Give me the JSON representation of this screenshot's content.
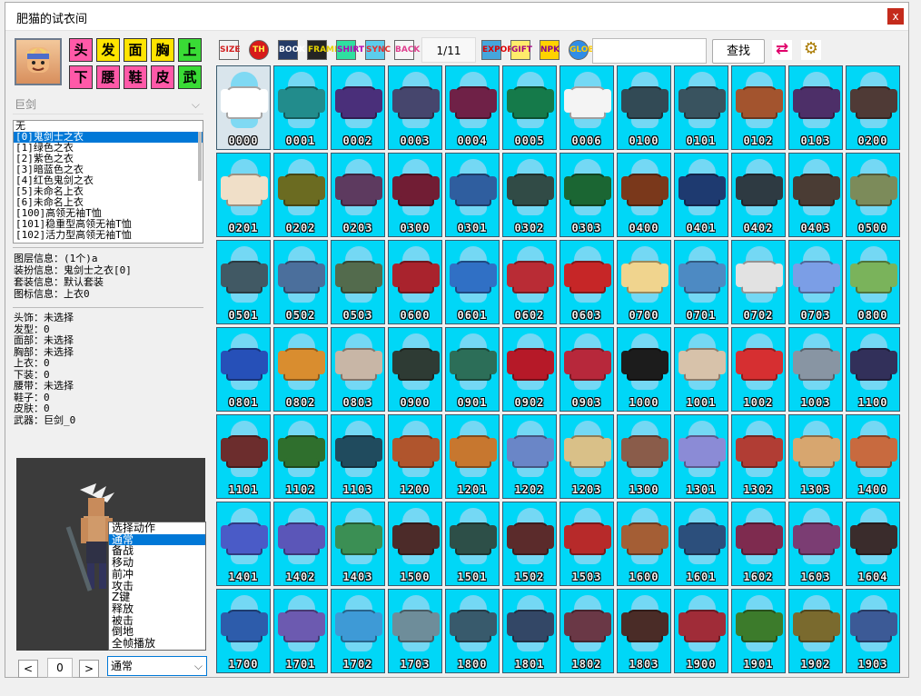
{
  "window": {
    "title": "肥猫的试衣间",
    "close_label": "x"
  },
  "weapon_type": "巨剑",
  "categories": [
    "头",
    "发",
    "面",
    "胸",
    "上",
    "下",
    "腰",
    "鞋",
    "皮",
    "武"
  ],
  "equip_list": [
    "无",
    "[0]鬼剑士之衣",
    "[1]绿色之衣",
    "[2]紫色之衣",
    "[3]暗蓝色之衣",
    "[4]红色鬼剑之衣",
    "[5]未命名上衣",
    "[6]未命名上衣",
    "[100]高领无袖T恤",
    "[101]稳重型高领无袖T恤",
    "[102]活力型高领无袖T恤"
  ],
  "layer_info": [
    "图层信息：(1个)a",
    "装扮信息：鬼剑士之衣[0]",
    "套装信息：默认套装",
    "图标信息：上衣0"
  ],
  "equipment": [
    "头饰：未选择",
    "发型：0",
    "面部：未选择",
    "胸部：未选择",
    "上衣：0",
    "下装：0",
    "腰带：未选择",
    "鞋子：0",
    "皮肤：0",
    "武器：巨剑_0"
  ],
  "actions": [
    "选择动作",
    "通常",
    "备战",
    "移动",
    "前冲",
    "攻击",
    "Z键",
    "释放",
    "被击",
    "倒地",
    "全帧播放"
  ],
  "selected_action": "通常",
  "frame_index": "0",
  "nav": {
    "prev": "<",
    "next": ">"
  },
  "toolbar": {
    "buttons": [
      "SIZE",
      "TH",
      "BOOK",
      "FRAME",
      "SHIRT",
      "SYNC",
      "BACK",
      "EXPORT",
      "GIFT",
      "NPK",
      "GLOBE"
    ],
    "page": "1/11",
    "search_label": "查找",
    "search_value": "",
    "search_placeholder": ""
  },
  "items": [
    "0000",
    "0001",
    "0002",
    "0003",
    "0004",
    "0005",
    "0006",
    "0100",
    "0101",
    "0102",
    "0103",
    "0200",
    "0201",
    "0202",
    "0203",
    "0300",
    "0301",
    "0302",
    "0303",
    "0400",
    "0401",
    "0402",
    "0403",
    "0500",
    "0501",
    "0502",
    "0503",
    "0600",
    "0601",
    "0602",
    "0603",
    "0700",
    "0701",
    "0702",
    "0703",
    "0800",
    "0801",
    "0802",
    "0803",
    "0900",
    "0901",
    "0902",
    "0903",
    "1000",
    "1001",
    "1002",
    "1003",
    "1100",
    "1101",
    "1102",
    "1103",
    "1200",
    "1201",
    "1202",
    "1203",
    "1300",
    "1301",
    "1302",
    "1303",
    "1400",
    "1401",
    "1402",
    "1403",
    "1500",
    "1501",
    "1502",
    "1503",
    "1600",
    "1601",
    "1602",
    "1603",
    "1604",
    "1700",
    "1701",
    "1702",
    "1703",
    "1800",
    "1801",
    "1802",
    "1803",
    "1900",
    "1901",
    "1902",
    "1903"
  ],
  "item_colors": [
    "#ffffff",
    "#228c8c",
    "#4a2f7a",
    "#46466d",
    "#6f2147",
    "#157a4a",
    "#f4f4f4",
    "#324a55",
    "#39535f",
    "#a3542e",
    "#4d2f68",
    "#4f3a36",
    "#f0dfc8",
    "#6b6b21",
    "#5d3a5f",
    "#711d34",
    "#2f5e9f",
    "#314b46",
    "#1b6633",
    "#7a381b",
    "#1e3a70",
    "#2e3a42",
    "#4a3c34",
    "#7c8b5a",
    "#415964",
    "#4b6f9c",
    "#536b4d",
    "#a9232d",
    "#3070c5",
    "#b92c35",
    "#c62627",
    "#f0d48e",
    "#4d8ac3",
    "#e2e2e2",
    "#7b9ee6",
    "#7ab35b",
    "#2650b8",
    "#d98d2f",
    "#c8b6a6",
    "#2e3b34",
    "#2c6e58",
    "#b61928",
    "#b7283b",
    "#1c1c1c",
    "#d7c2aa",
    "#d62f31",
    "#8895a3",
    "#32305a",
    "#6c2d2d",
    "#2f6f2d",
    "#204b5e",
    "#b0552d",
    "#c7772f",
    "#6a86c7",
    "#d9c088",
    "#8a5c4a",
    "#8b8bd6",
    "#b13d34",
    "#d7a66f",
    "#c86a3f",
    "#4a5bc7",
    "#5b56b8",
    "#3b8f54",
    "#4c2b29",
    "#2d4f48",
    "#5b2b2b",
    "#b72a2a",
    "#a45e35",
    "#2c4f7c",
    "#7e2b4f",
    "#7b3d73",
    "#3a2c2c",
    "#2d5cab",
    "#6c5ab0",
    "#3e9ad6",
    "#6e8d9a",
    "#385a6c",
    "#334766",
    "#6a3846",
    "#4a2c27",
    "#a02c38",
    "#3c7b2b",
    "#7a6a2e",
    "#3c5a96"
  ]
}
